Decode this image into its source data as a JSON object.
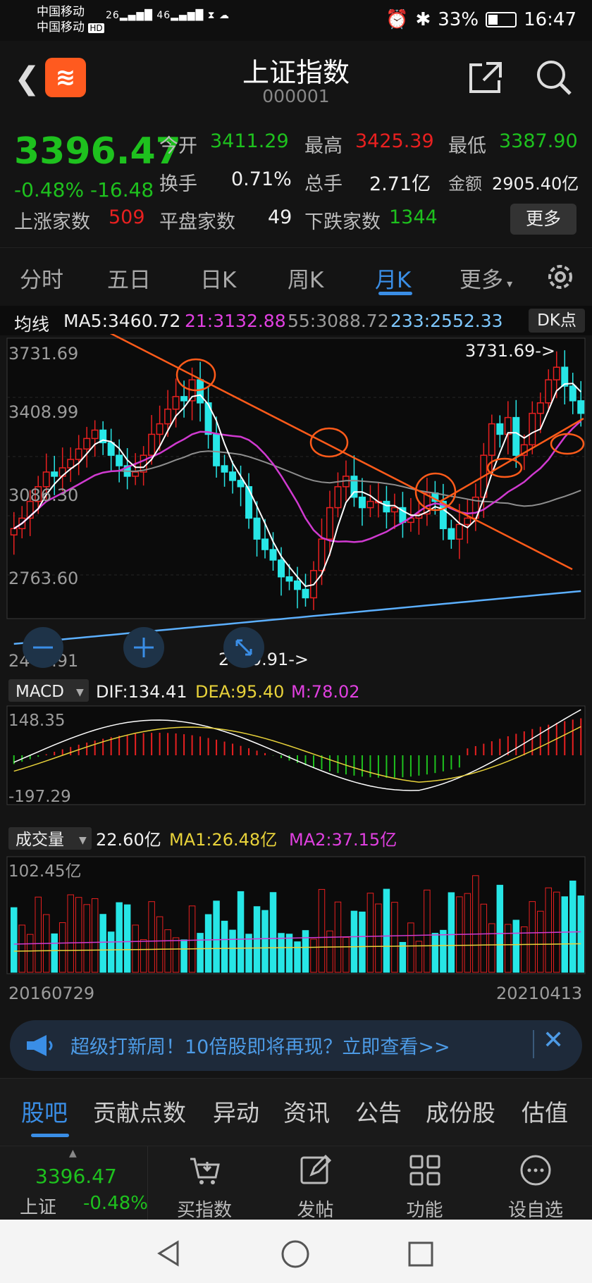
{
  "status": {
    "carrier1": "中国移动",
    "carrier2": "中国移动",
    "hd": "HD",
    "net1": "26",
    "net2": "46",
    "battery": "33%",
    "time": "16:47"
  },
  "header": {
    "title": "上证指数",
    "code": "000001"
  },
  "quote": {
    "price": "3396.47",
    "change_pct": "-0.48%",
    "change_abs": "-16.48",
    "open_label": "今开",
    "open": "3411.29",
    "high_label": "最高",
    "high": "3425.39",
    "low_label": "最低",
    "low": "3387.90",
    "turnover_label": "换手",
    "turnover": "0.71%",
    "volume_label": "总手",
    "volume": "2.71亿",
    "amount_label": "金额",
    "amount": "2905.40亿",
    "up_label": "上涨家数",
    "up": "509",
    "flat_label": "平盘家数",
    "flat": "49",
    "down_label": "下跌家数",
    "down": "1344",
    "more": "更多"
  },
  "tabs": [
    "分时",
    "五日",
    "日K",
    "周K",
    "月K",
    "更多"
  ],
  "ma": {
    "label": "均线",
    "ma5": "MA5:3460.72",
    "ma21": "21:3132.88",
    "ma55": "55:3088.72",
    "ma233": "233:2552.33",
    "dk": "DK点"
  },
  "kchart": {
    "y_labels": [
      "3731.69",
      "3408.99",
      "3086.30",
      "2763.60",
      "2440.91"
    ],
    "max_note": "3731.69->",
    "min_note": "2440.91->",
    "macd_label": "MACD",
    "dif": "DIF:134.41",
    "dea": "DEA:95.40",
    "m": "M:78.02",
    "macd_top": "148.35",
    "macd_bottom": "-197.29",
    "vol_label": "成交量",
    "vol": "22.60亿",
    "vol_ma1": "MA1:26.48亿",
    "vol_ma2": "MA2:37.15亿",
    "vol_top": "102.45亿",
    "date_start": "20160729",
    "date_end": "20210413"
  },
  "ad": {
    "text": "超级打新周！10倍股即将再现？立即查看>>"
  },
  "bottom_tabs": [
    "股吧",
    "贡献点数",
    "异动",
    "资讯",
    "公告",
    "成份股",
    "估值"
  ],
  "toolbar": {
    "price": "3396.47",
    "name": "上证",
    "pct": "-0.48%",
    "items": [
      "买指数",
      "发帖",
      "功能",
      "设自选"
    ]
  },
  "colors": {
    "up": "#e82020",
    "down": "#1ec11e",
    "accent": "#3a8ee6",
    "candle_down": "#27e6e6"
  }
}
